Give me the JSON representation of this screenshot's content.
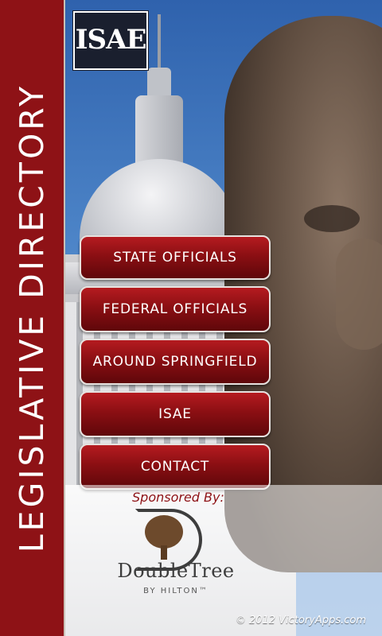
{
  "sidebar": {
    "title": "LEGISLATIVE DIRECTORY"
  },
  "logo": {
    "text": "ISAE"
  },
  "menu": {
    "items": [
      {
        "label": "STATE OFFICIALS"
      },
      {
        "label": "FEDERAL OFFICIALS"
      },
      {
        "label": "AROUND SPRINGFIELD"
      },
      {
        "label": "ISAE"
      },
      {
        "label": "CONTACT"
      }
    ]
  },
  "sponsor": {
    "label": "Sponsored By:",
    "name": "DoubleTree",
    "subtitle": "BY HILTON™"
  },
  "footer": {
    "copyright": "© 2012 VictoryApps.com"
  },
  "colors": {
    "brand_red": "#8e1216",
    "button_red": "#b51b20",
    "sky": "#3b6fb3"
  }
}
